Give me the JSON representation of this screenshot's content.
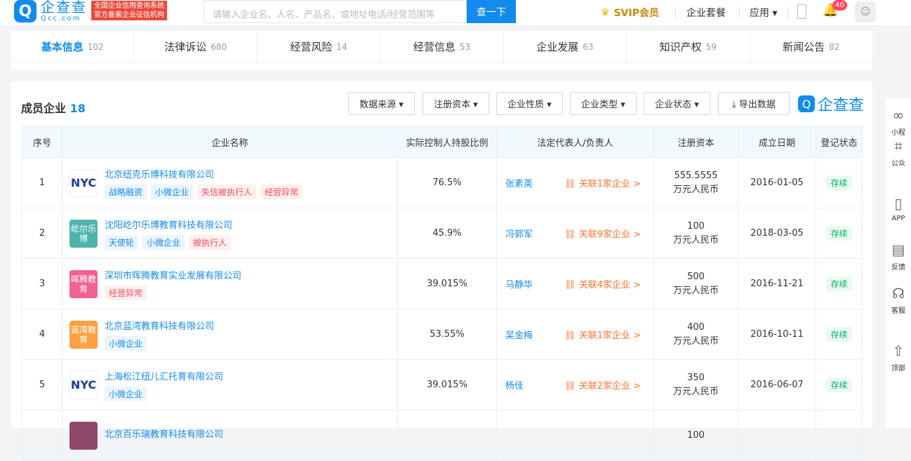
{
  "header": {
    "logo_mark": "Q",
    "logo_cn": "企查查",
    "logo_en": "Qcc.com",
    "badge_line1": "全国企业信用查询系统",
    "badge_line2": "官方备案企业征信机构",
    "search_placeholder": "请输入企业名、人名、产品名，或地址电话/经营范围等",
    "search_button": "查一下",
    "svip_label": "SVIP会员",
    "nav": [
      "企业套餐",
      "应用 ▾"
    ],
    "notification_count": "40"
  },
  "tabs": [
    {
      "label": "基本信息",
      "count": "102"
    },
    {
      "label": "法律诉讼",
      "count": "680"
    },
    {
      "label": "经营风险",
      "count": "14"
    },
    {
      "label": "经营信息",
      "count": "53"
    },
    {
      "label": "企业发展",
      "count": "63"
    },
    {
      "label": "知识产权",
      "count": "59"
    },
    {
      "label": "新闻公告",
      "count": "82"
    }
  ],
  "panel": {
    "title": "成员企业",
    "count": "18",
    "filters": [
      "数据来源 ▾",
      "注册资本 ▾",
      "企业性质 ▾",
      "企业类型 ▾",
      "企业状态 ▾",
      "⤓ 导出数据"
    ],
    "brand": "企查查"
  },
  "table": {
    "headers": [
      "序号",
      "企业名称",
      "实际控制人持股比例",
      "法定代表人/负责人",
      "注册资本",
      "成立日期",
      "登记状态"
    ],
    "rows": [
      {
        "no": "1",
        "logo": "NYC",
        "name": "北京纽克乐博科技有限公司",
        "tags": [
          "战略融资",
          "小微企业",
          "失信被执行人",
          "经营异常"
        ],
        "ratio": "76.5%",
        "person": "张素英",
        "related": "关联1家企业 >",
        "cap_amount": "555.5555",
        "cap_unit": "万元人民币",
        "date": "2016-01-05",
        "status": "存续"
      },
      {
        "no": "2",
        "logo": "屹尔乐博",
        "name": "沈阳屹尔乐博教育科技有限公司",
        "tags": [
          "天使轮",
          "小微企业",
          "被执行人"
        ],
        "ratio": "45.9%",
        "person": "冯郭军",
        "related": "关联9家企业 >",
        "cap_amount": "100",
        "cap_unit": "万元人民币",
        "date": "2018-03-05",
        "status": "存续"
      },
      {
        "no": "3",
        "logo": "晖腾教育",
        "name": "深圳市晖腾教育实业发展有限公司",
        "tags": [
          "经营异常"
        ],
        "ratio": "39.015%",
        "person": "马静华",
        "related": "关联4家企业 >",
        "cap_amount": "500",
        "cap_unit": "万元人民币",
        "date": "2016-11-21",
        "status": "存续"
      },
      {
        "no": "4",
        "logo": "蓝湾教育",
        "name": "北京蓝湾教育科技有限公司",
        "tags": [
          "小微企业"
        ],
        "ratio": "53.55%",
        "person": "吴金梅",
        "related": "关联1家企业 >",
        "cap_amount": "400",
        "cap_unit": "万元人民币",
        "date": "2016-10-11",
        "status": "存续"
      },
      {
        "no": "5",
        "logo": "NYC",
        "name": "上海松江纽儿汇托育有限公司",
        "tags": [
          "小微企业"
        ],
        "ratio": "39.015%",
        "person": "杨佳",
        "related": "关联2家企业 >",
        "cap_amount": "350",
        "cap_unit": "万元人民币",
        "date": "2016-06-07",
        "status": "存续"
      },
      {
        "no": "",
        "logo": "",
        "name": "北京百乐瑞教育科技有限公司",
        "tags": [],
        "ratio": "",
        "person": "",
        "related": "",
        "cap_amount": "100",
        "cap_unit": "",
        "date": "",
        "status": ""
      }
    ]
  },
  "sidebar": [
    "小程",
    "公众",
    "APP",
    "反馈",
    "客服",
    "顶部"
  ],
  "colors": {
    "brand": "#128bed",
    "danger": "#fd485e",
    "orange": "#ff722d",
    "green": "#00ad65"
  }
}
